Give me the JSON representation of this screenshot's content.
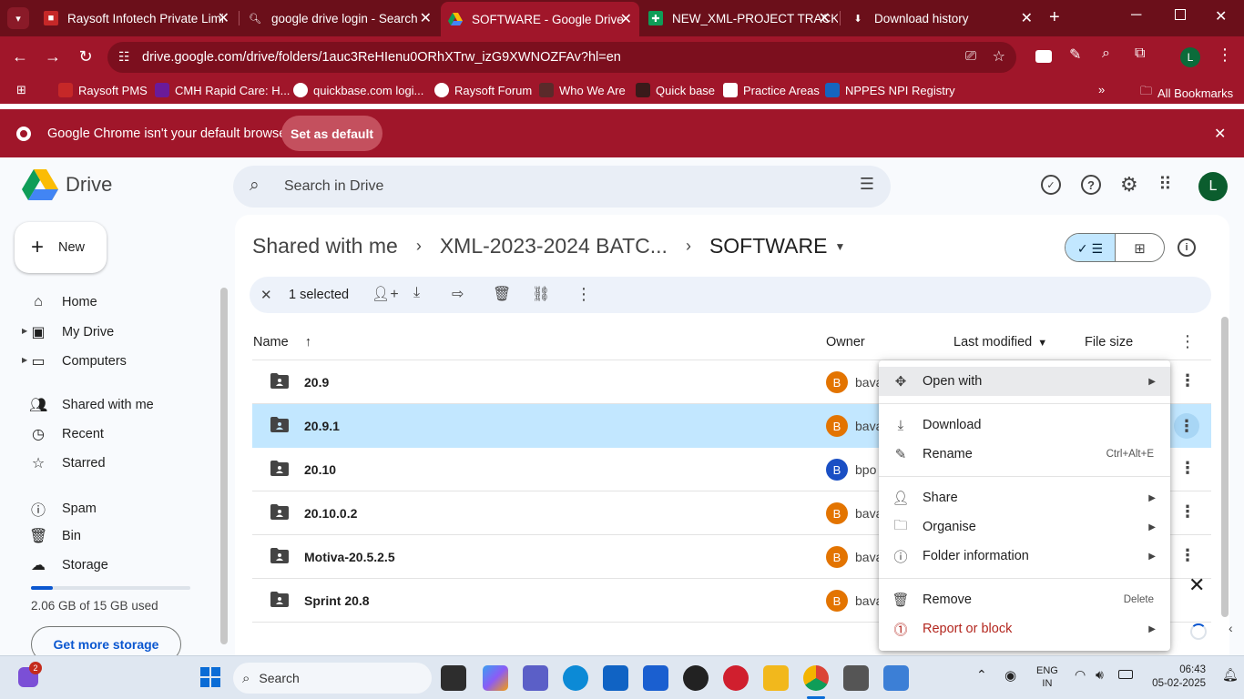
{
  "browser": {
    "tabs": [
      {
        "title": "Raysoft Infotech Private Limi"
      },
      {
        "title": "google drive login - Search"
      },
      {
        "title": "SOFTWARE - Google Drive"
      },
      {
        "title": "NEW_XML-PROJECT TRACKIN"
      },
      {
        "title": "Download history"
      }
    ],
    "url": "drive.google.com/drive/folders/1auc3ReHIenu0ORhXTrw_izG9XWNOZFAv?hl=en",
    "profile_initial": "L",
    "bookmarks": [
      "Raysoft PMS",
      "CMH Rapid Care: H...",
      "quickbase.com logi...",
      "Raysoft Forum",
      "Who We Are",
      "Quick base",
      "Practice Areas",
      "NPPES NPI Registry"
    ],
    "all_bookmarks": "All Bookmarks",
    "infobar_text": "Google Chrome isn't your default browser",
    "infobar_button": "Set as default"
  },
  "drive": {
    "logo_text": "Drive",
    "search_placeholder": "Search in Drive",
    "avatar_initial": "L",
    "new_label": "New",
    "sidebar": [
      {
        "label": "Home",
        "icon": "home-icon"
      },
      {
        "label": "My Drive",
        "icon": "my-drive-icon"
      },
      {
        "label": "Computers",
        "icon": "computer-icon"
      },
      {
        "label": "Shared with me",
        "icon": "people-icon"
      },
      {
        "label": "Recent",
        "icon": "clock-icon"
      },
      {
        "label": "Starred",
        "icon": "star-icon"
      },
      {
        "label": "Spam",
        "icon": "spam-icon"
      },
      {
        "label": "Bin",
        "icon": "bin-icon"
      },
      {
        "label": "Storage",
        "icon": "cloud-icon"
      }
    ],
    "storage_used_text": "2.06 GB of 15 GB used",
    "storage_fraction": 0.137,
    "get_storage": "Get more storage",
    "breadcrumb": [
      "Shared with me",
      "XML-2023-2024 BATC...",
      "SOFTWARE"
    ],
    "selection_text": "1 selected",
    "columns": {
      "name": "Name",
      "owner": "Owner",
      "modified": "Last modified",
      "size": "File size"
    },
    "files": [
      {
        "name": "20.9",
        "owner": "bava",
        "initial": "B",
        "color": "#e37400"
      },
      {
        "name": "20.9.1",
        "owner": "bava",
        "initial": "B",
        "color": "#e37400",
        "selected": true
      },
      {
        "name": "20.10",
        "owner": "bpo",
        "initial": "B",
        "color": "#1a4fc4"
      },
      {
        "name": "20.10.0.2",
        "owner": "bava",
        "initial": "B",
        "color": "#e37400"
      },
      {
        "name": "Motiva-20.5.2.5",
        "owner": "bava",
        "initial": "B",
        "color": "#e37400"
      },
      {
        "name": "Sprint 20.8",
        "owner": "bava",
        "initial": "B",
        "color": "#e37400"
      }
    ]
  },
  "context_menu": {
    "items": [
      {
        "label": "Open with",
        "icon": "move-icon",
        "submenu": true
      },
      {
        "label": "Download",
        "icon": "download-icon"
      },
      {
        "label": "Rename",
        "icon": "pencil-icon",
        "shortcut": "Ctrl+Alt+E"
      },
      {
        "label": "Share",
        "icon": "share-icon",
        "submenu": true
      },
      {
        "label": "Organise",
        "icon": "folder-icon",
        "submenu": true
      },
      {
        "label": "Folder information",
        "icon": "info-icon",
        "submenu": true
      },
      {
        "label": "Remove",
        "icon": "bin-icon",
        "shortcut": "Delete"
      },
      {
        "label": "Report or block",
        "icon": "report-icon",
        "submenu": true
      }
    ]
  },
  "taskbar": {
    "search_label": "Search",
    "notification_count": "2",
    "lang_top": "ENG",
    "lang_bottom": "IN",
    "time": "06:43",
    "date": "05-02-2025"
  }
}
